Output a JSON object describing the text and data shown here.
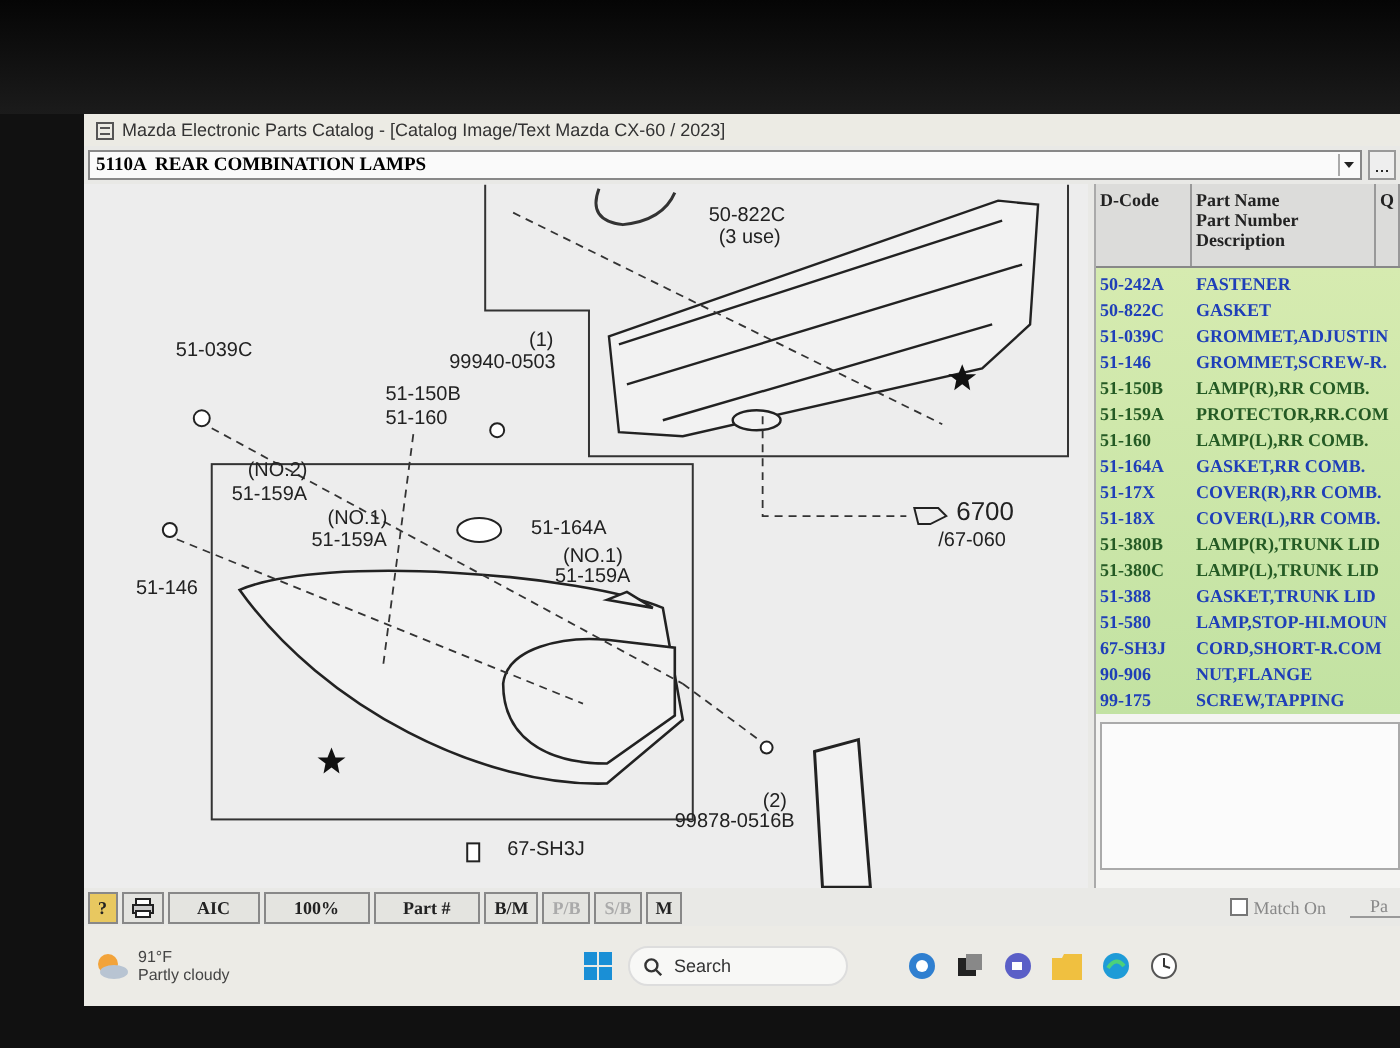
{
  "window": {
    "title": "Mazda Electronic Parts Catalog - [Catalog Image/Text Mazda CX-60 / 2023]"
  },
  "section_select": {
    "value": "5110A  REAR COMBINATION LAMPS",
    "more_button": "..."
  },
  "diagram": {
    "callouts": [
      "50-822C",
      "(3 use)",
      "51-039C",
      "(1)",
      "99940-0503",
      "51-150B",
      "51-160",
      "(NO.2)",
      "51-159A",
      "(NO.1)",
      "51-159A",
      "51-164A",
      "(NO.1)",
      "51-159A",
      "51-146",
      "6700",
      "/67-060",
      "(2)",
      "99878-0516B",
      "67-SH3J"
    ]
  },
  "parts_table": {
    "columns": [
      "D-Code",
      "Part Name\nPart Number\nDescription",
      "Q"
    ],
    "rows": [
      {
        "code": "50-242A",
        "name": "FASTENER",
        "color": "#1f3fb8"
      },
      {
        "code": "50-822C",
        "name": "GASKET",
        "color": "#1f3fb8"
      },
      {
        "code": "51-039C",
        "name": "GROMMET,ADJUSTIN",
        "color": "#1f3fb8"
      },
      {
        "code": "51-146",
        "name": "GROMMET,SCREW-R.",
        "color": "#1f3fb8"
      },
      {
        "code": "51-150B",
        "name": "LAMP(R),RR COMB.",
        "color": "#245a24"
      },
      {
        "code": "51-159A",
        "name": "PROTECTOR,RR.COM",
        "color": "#245a24"
      },
      {
        "code": "51-160",
        "name": "LAMP(L),RR COMB.",
        "color": "#245a24"
      },
      {
        "code": "51-164A",
        "name": "GASKET,RR COMB.",
        "color": "#1f3fb8"
      },
      {
        "code": "51-17X",
        "name": "COVER(R),RR COMB.",
        "color": "#1f3fb8"
      },
      {
        "code": "51-18X",
        "name": "COVER(L),RR COMB.",
        "color": "#1f3fb8"
      },
      {
        "code": "51-380B",
        "name": "LAMP(R),TRUNK LID",
        "color": "#245a24"
      },
      {
        "code": "51-380C",
        "name": "LAMP(L),TRUNK LID",
        "color": "#245a24"
      },
      {
        "code": "51-388",
        "name": "GASKET,TRUNK LID",
        "color": "#1f3fb8"
      },
      {
        "code": "51-580",
        "name": "LAMP,STOP-HI.MOUN",
        "color": "#1f3fb8"
      },
      {
        "code": "67-SH3J",
        "name": "CORD,SHORT-R.COM",
        "color": "#1f3fb8"
      },
      {
        "code": "90-906",
        "name": "NUT,FLANGE",
        "color": "#1f3fb8"
      },
      {
        "code": "99-175",
        "name": "SCREW,TAPPING",
        "color": "#1f3fb8"
      }
    ]
  },
  "toolbar": {
    "buttons": [
      {
        "kind": "help",
        "label": "?",
        "disabled": false
      },
      {
        "kind": "print",
        "disabled": false
      },
      {
        "kind": "text",
        "label": "AIC",
        "disabled": false
      },
      {
        "kind": "text",
        "label": "100%",
        "disabled": false
      },
      {
        "kind": "text",
        "label": "Part #",
        "disabled": false
      },
      {
        "kind": "text",
        "label": "B/M",
        "disabled": false
      },
      {
        "kind": "text",
        "label": "P/B",
        "disabled": true
      },
      {
        "kind": "text",
        "label": "S/B",
        "disabled": true
      },
      {
        "kind": "text",
        "label": "M",
        "disabled": false
      }
    ],
    "match_on": {
      "label": "Match On",
      "checked": false
    },
    "side_tab": "Pa"
  },
  "taskbar": {
    "weather": {
      "temperature": "91°F",
      "condition": "Partly cloudy"
    },
    "search": {
      "placeholder": "Search"
    }
  }
}
